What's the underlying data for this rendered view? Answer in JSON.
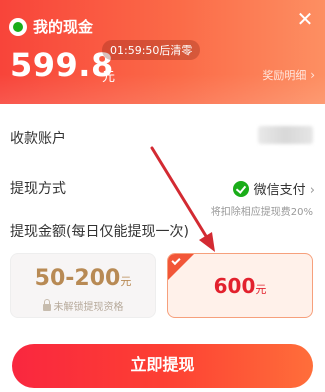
{
  "header": {
    "title": "我的现金",
    "amount": "599.8",
    "unit": "元",
    "timer": "01:59:50后清零",
    "reward_link": "奖励明细",
    "close_icon": "close-icon"
  },
  "rows": {
    "account_label": "收款账户",
    "method_label": "提现方式",
    "method_value": "微信支付",
    "fee_note": "将扣除相应提现费20%",
    "amount_label": "提现金额(每日仅能提现一次)"
  },
  "options": [
    {
      "value": "50-200",
      "unit": "元",
      "note": "未解锁提现资格",
      "selected": false
    },
    {
      "value": "600",
      "unit": "元",
      "selected": true
    }
  ],
  "button": {
    "label": "立即提现"
  },
  "colors": {
    "header_start": "#f8443a",
    "header_end": "#fd8f62",
    "wechat_green": "#1aad19",
    "selected_border": "#f6a07c",
    "selected_value": "#e2212d",
    "annotation_arrow": "#d32a32"
  }
}
